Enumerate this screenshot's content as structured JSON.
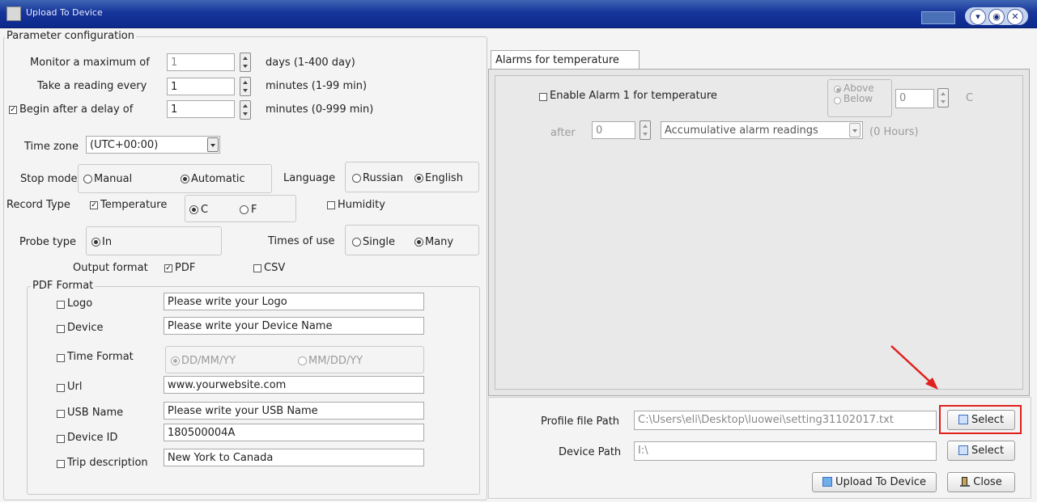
{
  "window": {
    "title": "Upload To Device"
  },
  "param": {
    "group_label": "Parameter configuration",
    "monitor_label": "Monitor a maximum of",
    "monitor_value": "1",
    "monitor_unit": "days (1-400 day)",
    "reading_label": "Take a reading every",
    "reading_value": "1",
    "reading_unit": "minutes (1-99 min)",
    "delay_label": "Begin after a delay of",
    "delay_value": "1",
    "delay_unit": "minutes (0-999 min)",
    "timezone_label": "Time zone",
    "timezone_value": "(UTC+00:00)",
    "stop_label": "Stop mode",
    "stop_manual": "Manual",
    "stop_auto": "Automatic",
    "language_label": "Language",
    "lang_russian": "Russian",
    "lang_english": "English",
    "record_label": "Record Type",
    "record_temp": "Temperature",
    "unit_c": "C",
    "unit_f": "F",
    "record_humidity": "Humidity",
    "probe_label": "Probe type",
    "probe_in": "In",
    "times_label": "Times of use",
    "times_single": "Single",
    "times_many": "Many",
    "output_label": "Output format",
    "output_pdf": "PDF",
    "output_csv": "CSV"
  },
  "pdf": {
    "group_label": "PDF Format",
    "logo_label": "Logo",
    "logo_value": "Please write your Logo",
    "device_label": "Device",
    "device_value": "Please write your Device Name",
    "time_label": "Time Format",
    "time_ddmm": "DD/MM/YY",
    "time_mmdd": "MM/DD/YY",
    "url_label": "Url",
    "url_value": "www.yourwebsite.com",
    "usb_label": "USB Name",
    "usb_value": "Please write your USB Name",
    "id_label": "Device ID",
    "id_value": "180500004A",
    "trip_label": "Trip description",
    "trip_value": "New York to Canada"
  },
  "alarms": {
    "tab_label": "Alarms for temperature",
    "enable_label": "Enable Alarm 1 for temperature",
    "above": "Above",
    "below": "Below",
    "threshold_value": "0",
    "threshold_unit": "C",
    "after_label": "after",
    "after_value": "0",
    "mode_value": "Accumulative alarm readings",
    "hours_text": "(0 Hours)"
  },
  "paths": {
    "profile_label": "Profile file Path",
    "profile_value": "C:\\Users\\eli\\Desktop\\luowei\\setting31102017.txt",
    "select_label": "Select",
    "device_label": "Device Path",
    "device_value": "I:\\",
    "select2_label": "Select",
    "upload_label": "Upload To Device",
    "close_label": "Close"
  },
  "annotation": {
    "highlight_color": "#e0201c",
    "arrow_color": "#e0201c"
  }
}
